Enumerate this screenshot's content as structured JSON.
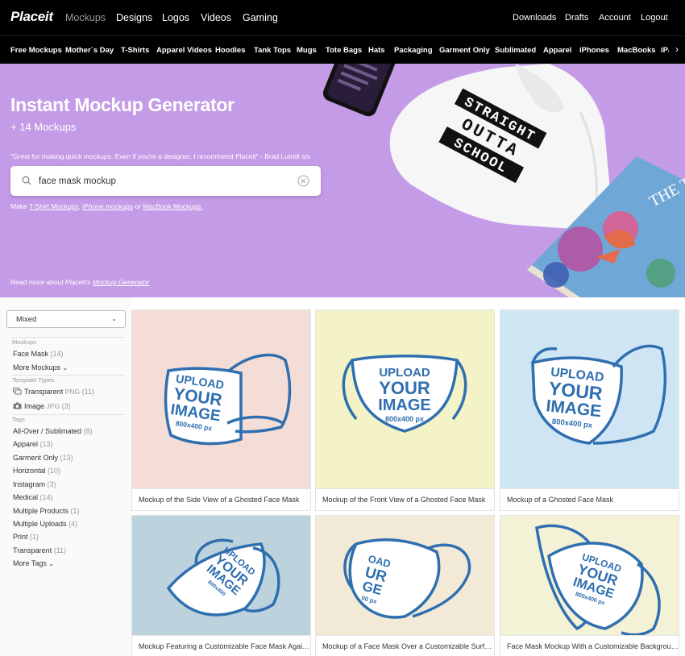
{
  "topnav": {
    "logo": "Placeit",
    "main_links": [
      "Mockups",
      "Designs",
      "Logos",
      "Videos",
      "Gaming"
    ],
    "right_links": [
      "Downloads",
      "Drafts",
      "Account",
      "Logout"
    ]
  },
  "catnav": {
    "items": [
      "Free Mockups",
      "Mother´s Day",
      "T-Shirts",
      "Apparel Videos",
      "Hoodies",
      "Tank Tops",
      "Mugs",
      "Tote Bags",
      "Hats",
      "Packaging",
      "Garment Only",
      "Sublimated",
      "Apparel",
      "iPhones",
      "MacBooks",
      "iPa"
    ],
    "arrow": "›"
  },
  "hero": {
    "title": "Instant Mockup Generator",
    "subtitle": "+ 14 Mockups",
    "quote": "\"Great for making quick mockups. Even if you're a designer, I recommend Placeit\" - Brad Lutrell s/s",
    "search_value": "face mask mockup",
    "make_prefix": "Make ",
    "make_link1": "T-Shirt Mockups",
    "make_sep1": ", ",
    "make_link2": "iPhone mockups",
    "make_sep2": " or ",
    "make_link3": "MacBook Mockups.",
    "readmore_prefix": "Read more about Placeit's ",
    "readmore_link": "Mockup Generator",
    "hoodie_lines": [
      "STRAIGHT",
      "OUTTA",
      "SCHOOL"
    ],
    "book_title": "THE TI DRAGON"
  },
  "sidebar": {
    "sort_value": "Mixed",
    "sort_chevron": "⌄",
    "mockups_head": "Mockups",
    "face_mask": {
      "label": "Face Mask",
      "count": "(14)"
    },
    "more_mockups": "More Mockups",
    "template_head": "Template Types",
    "transparent_type": {
      "label": "Transparent",
      "fmt": "PNG",
      "count": "(11)"
    },
    "image_type": {
      "label": "Image",
      "fmt": "JPG",
      "count": "(3)"
    },
    "tags_head": "Tags",
    "tags": [
      {
        "label": "All-Over / Sublimated",
        "count": "(8)"
      },
      {
        "label": "Apparel",
        "count": "(13)"
      },
      {
        "label": "Garment Only",
        "count": "(13)"
      },
      {
        "label": "Horizontal",
        "count": "(10)"
      },
      {
        "label": "Instagram",
        "count": "(3)"
      },
      {
        "label": "Medical",
        "count": "(14)"
      },
      {
        "label": "Multiple Products",
        "count": "(1)"
      },
      {
        "label": "Multiple Uploads",
        "count": "(4)"
      },
      {
        "label": "Print",
        "count": "(1)"
      },
      {
        "label": "Transparent",
        "count": "(11)"
      }
    ],
    "more_tags": "More Tags"
  },
  "cards": [
    {
      "caption": "Mockup of the Side View of a Ghosted Face Mask",
      "bg": "#f4ddd6",
      "mask_text": [
        "UPLOAD",
        "YOUR",
        "IMAGE",
        "800x400 px"
      ]
    },
    {
      "caption": "Mockup of the Front View of a Ghosted Face Mask",
      "bg": "#f3f3c7",
      "mask_text": [
        "UPLOAD",
        "YOUR",
        "IMAGE",
        "800x400 px"
      ]
    },
    {
      "caption": "Mockup of a Ghosted Face Mask",
      "bg": "#cfe5f3",
      "mask_text": [
        "UPLOAD",
        "YOUR",
        "IMAGE",
        "800x400 px"
      ]
    },
    {
      "caption": "Mockup Featuring a Customizable Face Mask Again...",
      "bg": "#bcd3de",
      "mask_text": [
        "UPLOAD",
        "YOUR",
        "IMAGE",
        "800x400"
      ]
    },
    {
      "caption": "Mockup of a Face Mask Over a Customizable Surface",
      "bg": "#f2ead6",
      "mask_text": [
        "OAD",
        "UR",
        "GE",
        "00 px"
      ]
    },
    {
      "caption": "Face Mask Mockup With a Customizable Background",
      "bg": "#f3f1d6",
      "mask_text": [
        "UPLOAD",
        "YOUR",
        "IMAGE",
        "800x400 px"
      ]
    }
  ],
  "colors": {
    "hero_bg": "#c49be6",
    "mask_trim": "#2f6fb0",
    "nav_bg": "#000000"
  }
}
